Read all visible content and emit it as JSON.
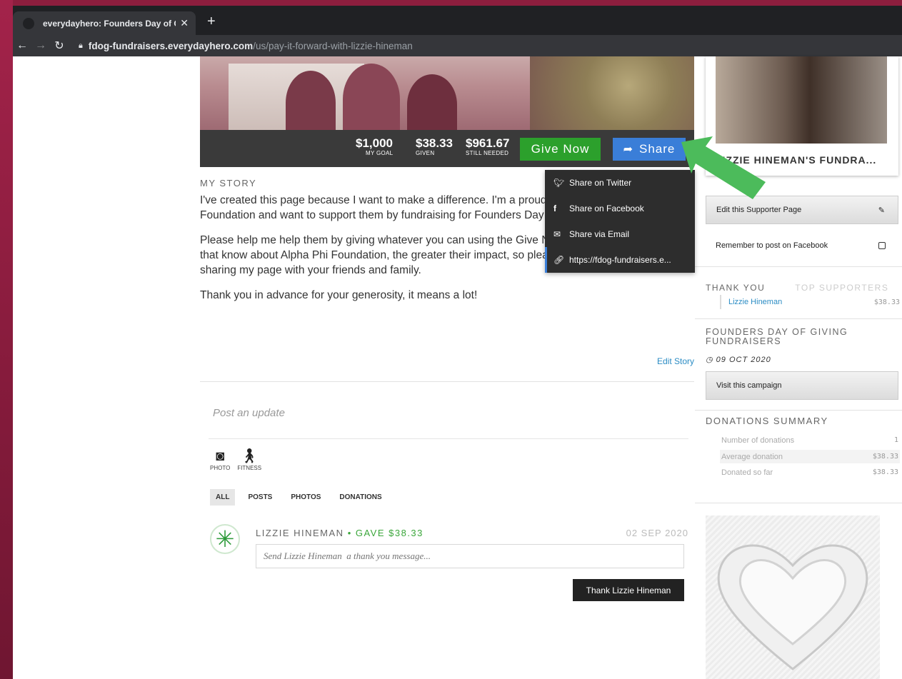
{
  "browser": {
    "tab_title": "everydayhero: Founders Day of Giving",
    "new_tab": "+",
    "url_host": "fdog-fundraisers.everydayhero.com",
    "url_path": "/us/pay-it-forward-with-lizzie-hineman"
  },
  "stats": {
    "goal_value": "$1,000",
    "goal_label": "MY GOAL",
    "given_value": "$38.33",
    "given_label": "GIVEN",
    "needed_value": "$961.67",
    "needed_label": "STILL NEEDED"
  },
  "actions": {
    "give_label": "Give Now",
    "share_label": "Share"
  },
  "share_menu": {
    "twitter": "Share on Twitter",
    "facebook": "Share on Facebook",
    "email": "Share via Email",
    "link": "https://fdog-fundraisers.e..."
  },
  "story": {
    "heading": "MY STORY",
    "p1": "I've created this page because I want to make a difference. I'm a proud supporter of the Alpha Phi Foundation and want to support them by fundraising for Founders Day of Giving.",
    "p2": "Please help me help them by giving whatever you can using the Give Now button. The more people that know about Alpha Phi Foundation, the greater their impact, so please also spread the word by sharing my page with your friends and family.",
    "p3": "Thank you in advance for your generosity, it means a lot!",
    "edit": "Edit Story"
  },
  "feed": {
    "post_placeholder": "Post an update",
    "photo_label": "PHOTO",
    "fitness_label": "FITNESS",
    "filters": [
      "ALL",
      "POSTS",
      "PHOTOS",
      "DONATIONS"
    ],
    "activity": {
      "name": "LIZZIE HINEMAN",
      "gave": " • GAVE $38.33",
      "date": "02 SEP 2020",
      "thank_placeholder": "Send Lizzie Hineman  a thank you message...",
      "thank_button": "Thank Lizzie Hineman"
    }
  },
  "sidebar": {
    "profile_title": "LIZZIE HINEMAN'S FUNDRA...",
    "edit_page": "Edit this Supporter Page",
    "remember_facebook": "Remember to post on Facebook",
    "tab_thank_you": "THANK YOU",
    "tab_top_supporters": "TOP SUPPORTERS",
    "supporter_name": "Lizzie Hineman",
    "supporter_amount": "$38.33",
    "campaign_title": "FOUNDERS DAY OF GIVING FUNDRAISERS",
    "campaign_date": "09 OCT 2020",
    "visit_campaign": "Visit this campaign",
    "donations_title": "DONATIONS SUMMARY",
    "donations": [
      {
        "label": "Number of donations",
        "value": "1"
      },
      {
        "label": "Average donation",
        "value": "$38.33"
      },
      {
        "label": "Donated so far",
        "value": "$38.33"
      }
    ]
  },
  "colors": {
    "give_green": "#2ca02c",
    "share_blue": "#3a7ed8",
    "annotation_arrow": "#4cbb5b"
  }
}
